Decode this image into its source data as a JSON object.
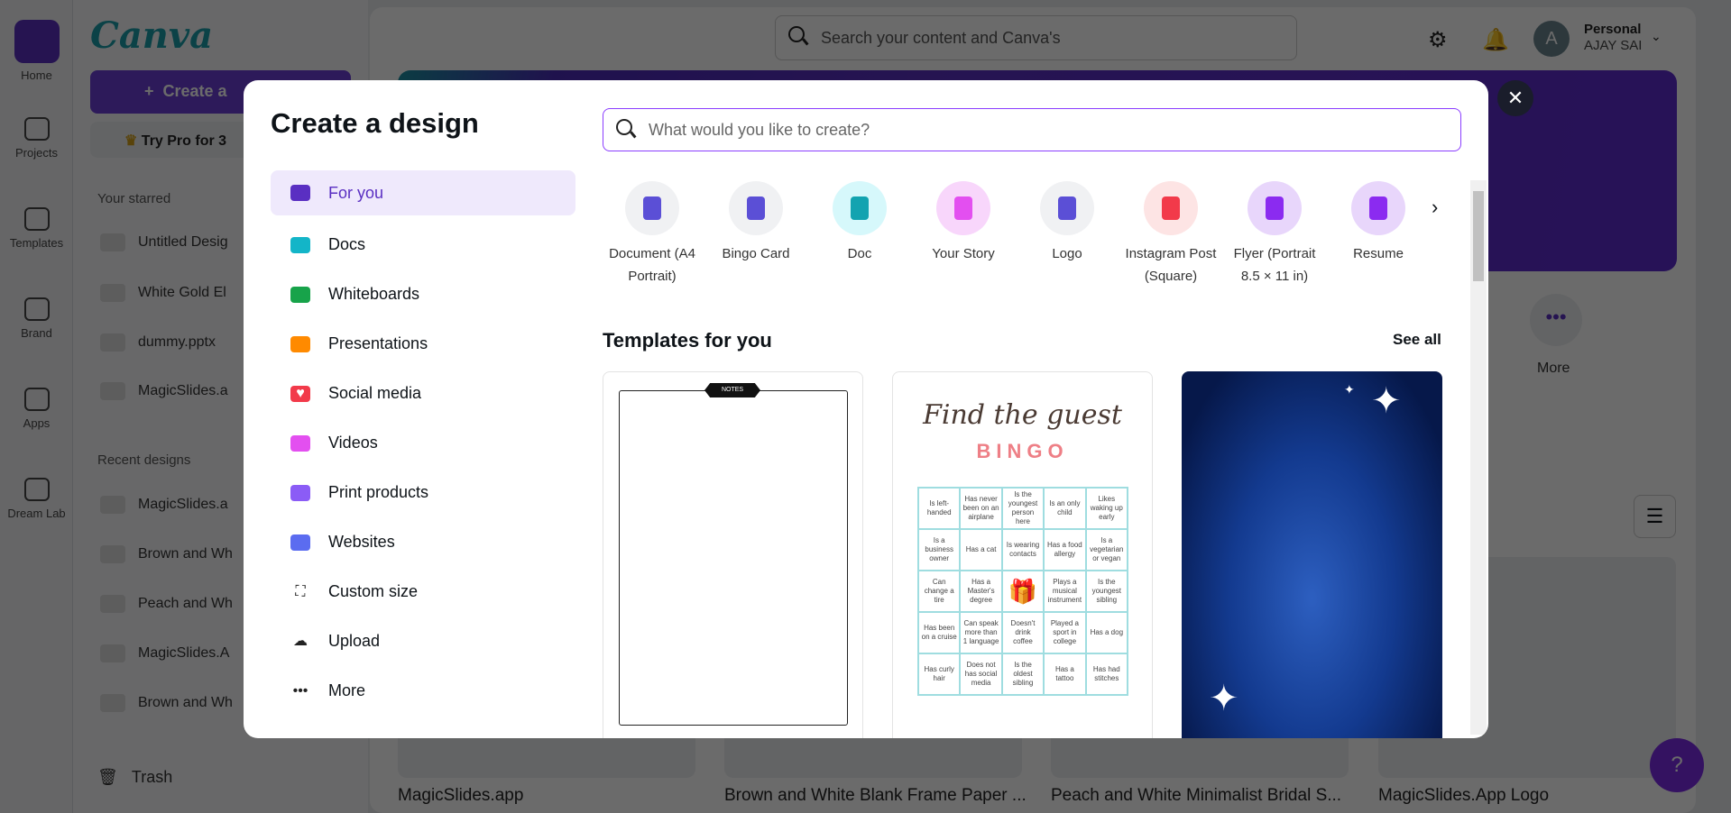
{
  "rail": [
    {
      "label": "Home"
    },
    {
      "label": "Projects"
    },
    {
      "label": "Templates"
    },
    {
      "label": "Brand"
    },
    {
      "label": "Apps"
    },
    {
      "label": "Dream Lab"
    }
  ],
  "sidebar": {
    "logo": "Canva",
    "create_label": "Create a",
    "pro_label": "Try Pro for 3",
    "starred_heading": "Your starred",
    "starred": [
      "Untitled Desig",
      "White Gold El",
      "dummy.pptx",
      "MagicSlides.a"
    ],
    "recent_heading": "Recent designs",
    "recent": [
      "MagicSlides.a",
      "Brown and Wh",
      "Peach and Wh",
      "MagicSlides.A",
      "Brown and Wh"
    ],
    "trash": "Trash"
  },
  "header": {
    "search_placeholder": "Search your content and Canva's",
    "account_type": "Personal",
    "account_name": "AJAY SAI",
    "avatar_letter": "A"
  },
  "main": {
    "more_label": "More",
    "cards": [
      "MagicSlides.app",
      "Brown and White Blank Frame Paper ...",
      "Peach and White Minimalist Bridal S...",
      "MagicSlides.App Logo"
    ],
    "help": "?"
  },
  "modal": {
    "title": "Create a design",
    "search_placeholder": "What would you like to create?",
    "menu": [
      "For you",
      "Docs",
      "Whiteboards",
      "Presentations",
      "Social media",
      "Videos",
      "Print products",
      "Websites",
      "Custom size",
      "Upload",
      "More"
    ],
    "types": [
      {
        "label": "Document (A4 Portrait)",
        "bg": "#f0f1f3",
        "fg": "#5b4fd6"
      },
      {
        "label": "Bingo Card",
        "bg": "#f0f1f3",
        "fg": "#5b4fd6"
      },
      {
        "label": "Doc",
        "bg": "#d6f8fb",
        "fg": "#13a3b0"
      },
      {
        "label": "Your Story",
        "bg": "#f8d6fb",
        "fg": "#e34ff0"
      },
      {
        "label": "Logo",
        "bg": "#f0f1f3",
        "fg": "#5b4fd6"
      },
      {
        "label": "Instagram Post (Square)",
        "bg": "#fde4e4",
        "fg": "#f23a4a"
      },
      {
        "label": "Flyer (Portrait 8.5 × 11 in)",
        "bg": "#e8d6fb",
        "fg": "#8b2bf0"
      },
      {
        "label": "Resume",
        "bg": "#e8d6fb",
        "fg": "#8b2bf0"
      }
    ],
    "templates_heading": "Templates for you",
    "see_all": "See all",
    "notes_tag": "NOTES",
    "bingo": {
      "heading": "Find the guest",
      "title": "BINGO",
      "cells": [
        "Is left-handed",
        "Has never been on an airplane",
        "Is the youngest person here",
        "Is an only child",
        "Likes waking up early",
        "Is a business owner",
        "Has a cat",
        "Is wearing contacts",
        "Has a food allergy",
        "Is a vegetarian or vegan",
        "Can change a tire",
        "Has a Master's degree",
        "",
        "Plays a musical instrument",
        "Is the youngest sibling",
        "Has been on a cruise",
        "Can speak more than 1 language",
        "Doesn't drink coffee",
        "Played a sport in college",
        "Has a dog",
        "Has curly hair",
        "Does not has social media",
        "Is the oldest sibling",
        "Has a tattoo",
        "Has had stitches"
      ]
    }
  },
  "colors": {
    "accent": "#8b3dff",
    "brand": "#6c3fd6"
  }
}
